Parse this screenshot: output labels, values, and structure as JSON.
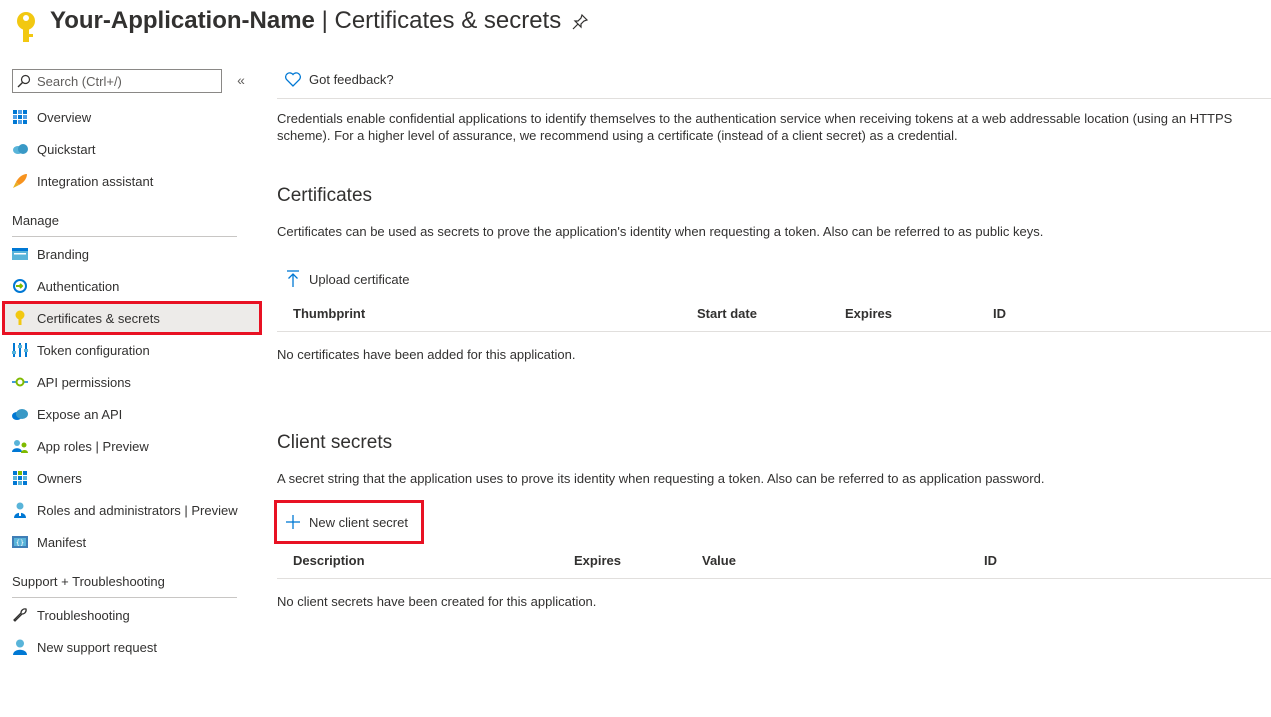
{
  "header": {
    "app_name": "Your-Application-Name",
    "separator": " | ",
    "page_name": "Certificates & secrets"
  },
  "sidebar": {
    "search_placeholder": "Search (Ctrl+/)",
    "collapse_glyph": "«",
    "top_items": [
      {
        "label": "Overview",
        "icon": "overview-icon"
      },
      {
        "label": "Quickstart",
        "icon": "quickstart-icon"
      },
      {
        "label": "Integration assistant",
        "icon": "rocket-icon"
      }
    ],
    "manage_heading": "Manage",
    "manage_items": [
      {
        "label": "Branding",
        "icon": "branding-icon"
      },
      {
        "label": "Authentication",
        "icon": "authentication-icon"
      },
      {
        "label": "Certificates & secrets",
        "icon": "key-icon",
        "active": true
      },
      {
        "label": "Token configuration",
        "icon": "token-config-icon"
      },
      {
        "label": "API permissions",
        "icon": "api-permissions-icon"
      },
      {
        "label": "Expose an API",
        "icon": "cloud-icon"
      },
      {
        "label": "App roles | Preview",
        "icon": "app-roles-icon"
      },
      {
        "label": "Owners",
        "icon": "owners-icon"
      },
      {
        "label": "Roles and administrators | Preview",
        "icon": "admin-icon"
      },
      {
        "label": "Manifest",
        "icon": "manifest-icon"
      }
    ],
    "support_heading": "Support + Troubleshooting",
    "support_items": [
      {
        "label": "Troubleshooting",
        "icon": "wrench-icon"
      },
      {
        "label": "New support request",
        "icon": "support-person-icon"
      }
    ]
  },
  "main": {
    "feedback_label": "Got feedback?",
    "intro": "Credentials enable confidential applications to identify themselves to the authentication service when receiving tokens at a web addressable location (using an HTTPS scheme). For a higher level of assurance, we recommend using a certificate (instead of a client secret) as a credential.",
    "certificates": {
      "heading": "Certificates",
      "description": "Certificates can be used as secrets to prove the application's identity when requesting a token. Also can be referred to as public keys.",
      "upload_label": "Upload certificate",
      "columns": [
        "Thumbprint",
        "Start date",
        "Expires",
        "ID"
      ],
      "empty_message": "No certificates have been added for this application."
    },
    "client_secrets": {
      "heading": "Client secrets",
      "description": "A secret string that the application uses to prove its identity when requesting a token. Also can be referred to as application password.",
      "new_label": "New client secret",
      "columns": [
        "Description",
        "Expires",
        "Value",
        "ID"
      ],
      "empty_message": "No client secrets have been created for this application."
    }
  },
  "colors": {
    "accent": "#0078d4",
    "highlight_box": "#e81123",
    "key_yellow": "#f2c811"
  }
}
